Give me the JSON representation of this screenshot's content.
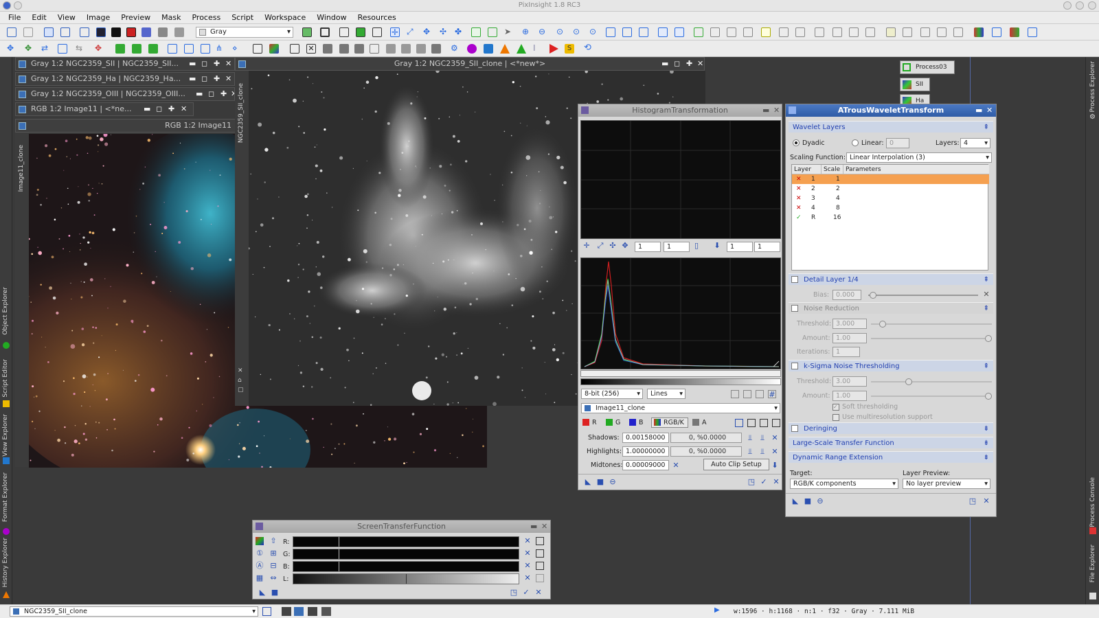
{
  "app": {
    "title": "PixInsight 1.8 RC3"
  },
  "menu": [
    "File",
    "Edit",
    "View",
    "Image",
    "Preview",
    "Mask",
    "Process",
    "Script",
    "Workspace",
    "Window",
    "Resources"
  ],
  "toolbar": {
    "colorspace_select": "Gray"
  },
  "side_left": [
    "Object Explorer",
    "Script Editor",
    "View Explorer",
    "Format Explorer",
    "History Explorer"
  ],
  "side_right": [
    "Process Explorer",
    "Process Console",
    "File Explorer"
  ],
  "windows": {
    "w1": "Gray 1:2 NGC2359_SII | NGC2359_SII...",
    "w2": "Gray 1:2 NGC2359_Ha | NGC2359_Ha...",
    "w3": "Gray 1:2 NGC2359_OIII | NGC2359_OIII...",
    "w4": "RGB 1:2 Image11 | <*ne...",
    "rgb_title": "RGB 1:2 Image11",
    "rgb_side": "Image11_clone",
    "gray_title": "Gray 1:2 NGC2359_SII_clone | <*new*>",
    "gray_side": "NGC2359_SII_clone"
  },
  "icons_desk": [
    "Process03",
    "SII",
    "Ha"
  ],
  "histogram": {
    "title": "HistogramTransformation",
    "zoom_values": [
      "1",
      "1",
      "1",
      "1"
    ],
    "bit_select": "8-bit (256)",
    "mode_select": "Lines",
    "view_select": "Image11_clone",
    "channels": [
      "R",
      "G",
      "B",
      "RGB/K",
      "A"
    ],
    "shadows_label": "Shadows:",
    "shadows": "0.00158000",
    "shadows_stat": "0, %0.0000",
    "highlights_label": "Highlights:",
    "highlights": "1.00000000",
    "highlights_stat": "0, %0.0000",
    "midtones_label": "Midtones:",
    "midtones": "0.00009000",
    "auto_clip": "Auto Clip Setup"
  },
  "atrous": {
    "title": "ATrousWaveletTransform",
    "wavelet_layers": "Wavelet Layers",
    "dyadic": "Dyadic",
    "linear": "Linear:",
    "linear_val": "0",
    "layers_label": "Layers:",
    "layers_val": "4",
    "scaling_label": "Scaling Function:",
    "scaling_val": "Linear Interpolation (3)",
    "col_layer": "Layer",
    "col_scale": "Scale",
    "col_params": "Parameters",
    "rows": [
      {
        "mark": "✕",
        "layer": "1",
        "scale": "1"
      },
      {
        "mark": "✕",
        "layer": "2",
        "scale": "2"
      },
      {
        "mark": "✕",
        "layer": "3",
        "scale": "4"
      },
      {
        "mark": "✕",
        "layer": "4",
        "scale": "8"
      },
      {
        "mark": "✓",
        "layer": "R",
        "scale": "16"
      }
    ],
    "detail_layer": "Detail Layer 1/4",
    "bias_label": "Bias:",
    "bias_val": "0.000",
    "noise_reduction": "Noise Reduction",
    "nr_threshold_label": "Threshold:",
    "nr_threshold": "3.000",
    "nr_amount_label": "Amount:",
    "nr_amount": "1.00",
    "nr_iter_label": "Iterations:",
    "nr_iter": "1",
    "ksigma": "k-Sigma Noise Thresholding",
    "ks_threshold_label": "Threshold:",
    "ks_threshold": "3.00",
    "ks_amount_label": "Amount:",
    "ks_amount": "1.00",
    "soft": "Soft thresholding",
    "multires": "Use multiresolution support",
    "deringing": "Deringing",
    "large_scale": "Large-Scale Transfer Function",
    "dre": "Dynamic Range Extension",
    "target_label": "Target:",
    "target_val": "RGB/K components",
    "preview_label": "Layer Preview:",
    "preview_val": "No layer preview"
  },
  "stf": {
    "title": "ScreenTransferFunction",
    "channels": [
      "R:",
      "G:",
      "B:",
      "L:"
    ]
  },
  "status": {
    "view": "NGC2359_SII_clone",
    "info": "w:1596 · h:1168 · n:1 · f32 · Gray · 7.111 MiB"
  }
}
